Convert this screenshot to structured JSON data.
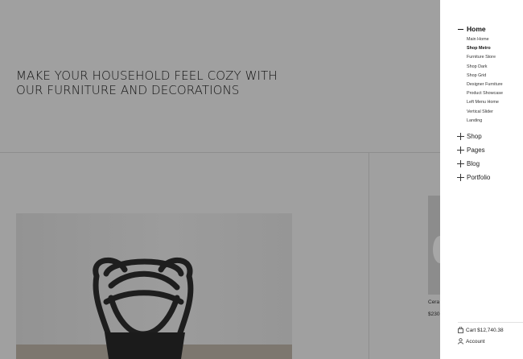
{
  "hero": {
    "title": "MAKE YOUR HOUSEHOLD FEEL COZY WITH OUR FURNITURE AND DECORATIONS"
  },
  "products": {
    "side_name": "Cera",
    "side_price": "$230"
  },
  "menu": {
    "home_label": "Home",
    "home_sub": [
      "Main Home",
      "Shop Metro",
      "Furniture Store",
      "Shop Dark",
      "Shop Grid",
      "Designer Furniture",
      "Product Showcase",
      "Left Menu Home",
      "Vertical Slider",
      "Landing"
    ],
    "active_sub": "Shop Metro",
    "items": [
      {
        "label": "Shop",
        "icon": "plus-icon"
      },
      {
        "label": "Pages",
        "icon": "plus-icon"
      },
      {
        "label": "Blog",
        "icon": "plus-icon"
      },
      {
        "label": "Portfolio",
        "icon": "plus-icon"
      }
    ],
    "cart_label": "Cart",
    "cart_total": "$12,740.38",
    "account_label": "Account"
  }
}
